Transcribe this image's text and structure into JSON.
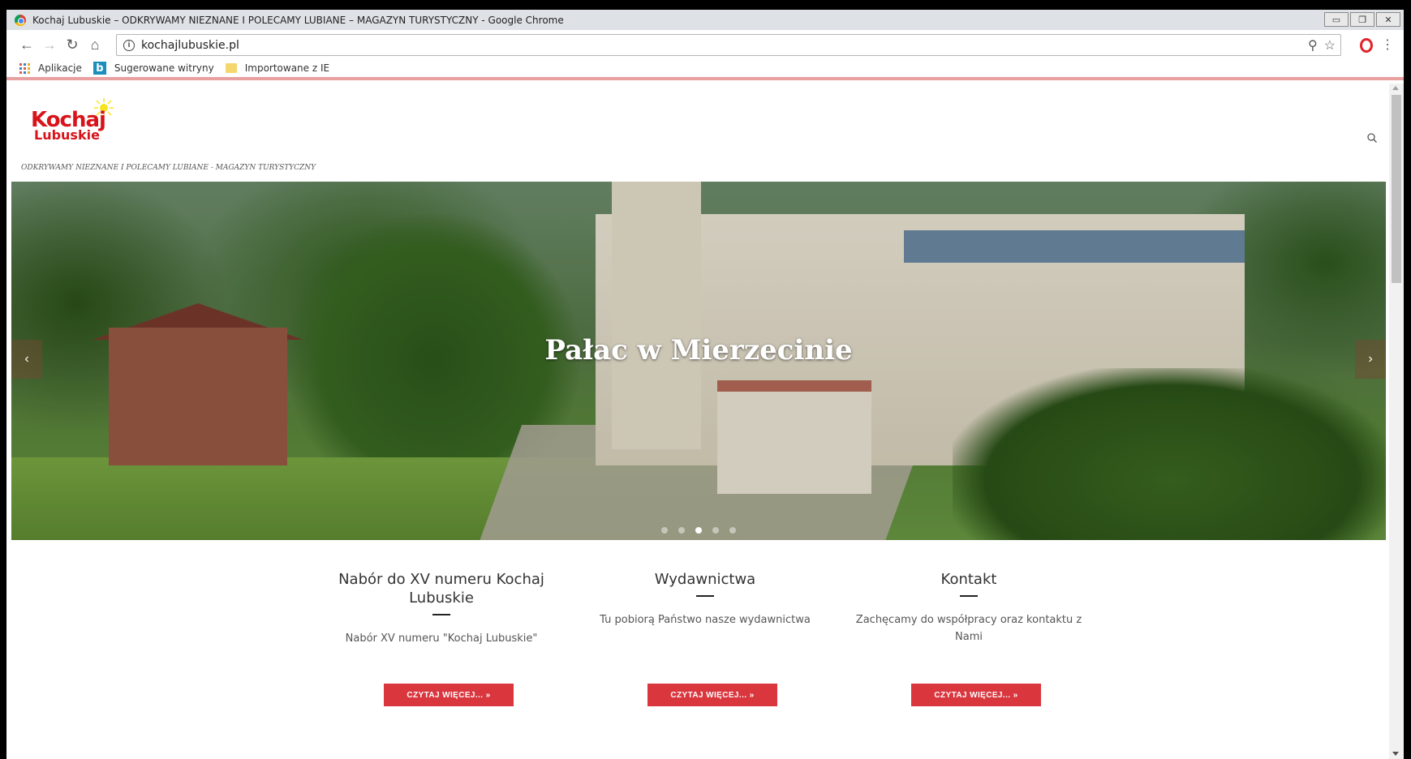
{
  "window": {
    "title": "Kochaj Lubuskie – ODKRYWAMY NIEZNANE I POLECAMY LUBIANE – MAGAZYN TURYSTYCZNY - Google Chrome"
  },
  "address_bar": {
    "url": "kochajlubuskie.pl"
  },
  "bookmarks": [
    {
      "label": "Aplikacje",
      "icon": "apps-icon"
    },
    {
      "label": "Sugerowane witryny",
      "icon": "bing-icon"
    },
    {
      "label": "Importowane z IE",
      "icon": "folder-icon"
    }
  ],
  "site": {
    "logo_line1": "Kochaj",
    "logo_line2": "Lubuskie",
    "tagline": "ODKRYWAMY NIEZNANE I POLECAMY LUBIANE - MAGAZYN TURYSTYCZNY"
  },
  "slider": {
    "title": "Pałac w Mierzecinie",
    "prev": "‹",
    "next": "›",
    "slide_count": 5,
    "active_slide": 3
  },
  "features": [
    {
      "heading": "Nabór do XV numeru Kochaj Lubuskie",
      "text": "Nabór XV numeru \"Kochaj Lubuskie\"",
      "button": "CZYTAJ WIĘCEJ... »"
    },
    {
      "heading": "Wydawnictwa",
      "text": "Tu pobiorą Państwo nasze wydawnictwa",
      "button": "CZYTAJ WIĘCEJ... »"
    },
    {
      "heading": "Kontakt",
      "text": "Zachęcamy do współpracy oraz kontaktu z Nami",
      "button": "CZYTAJ WIĘCEJ... »"
    }
  ],
  "colors": {
    "accent": "#d9363e",
    "logo_red": "#d7141a"
  }
}
